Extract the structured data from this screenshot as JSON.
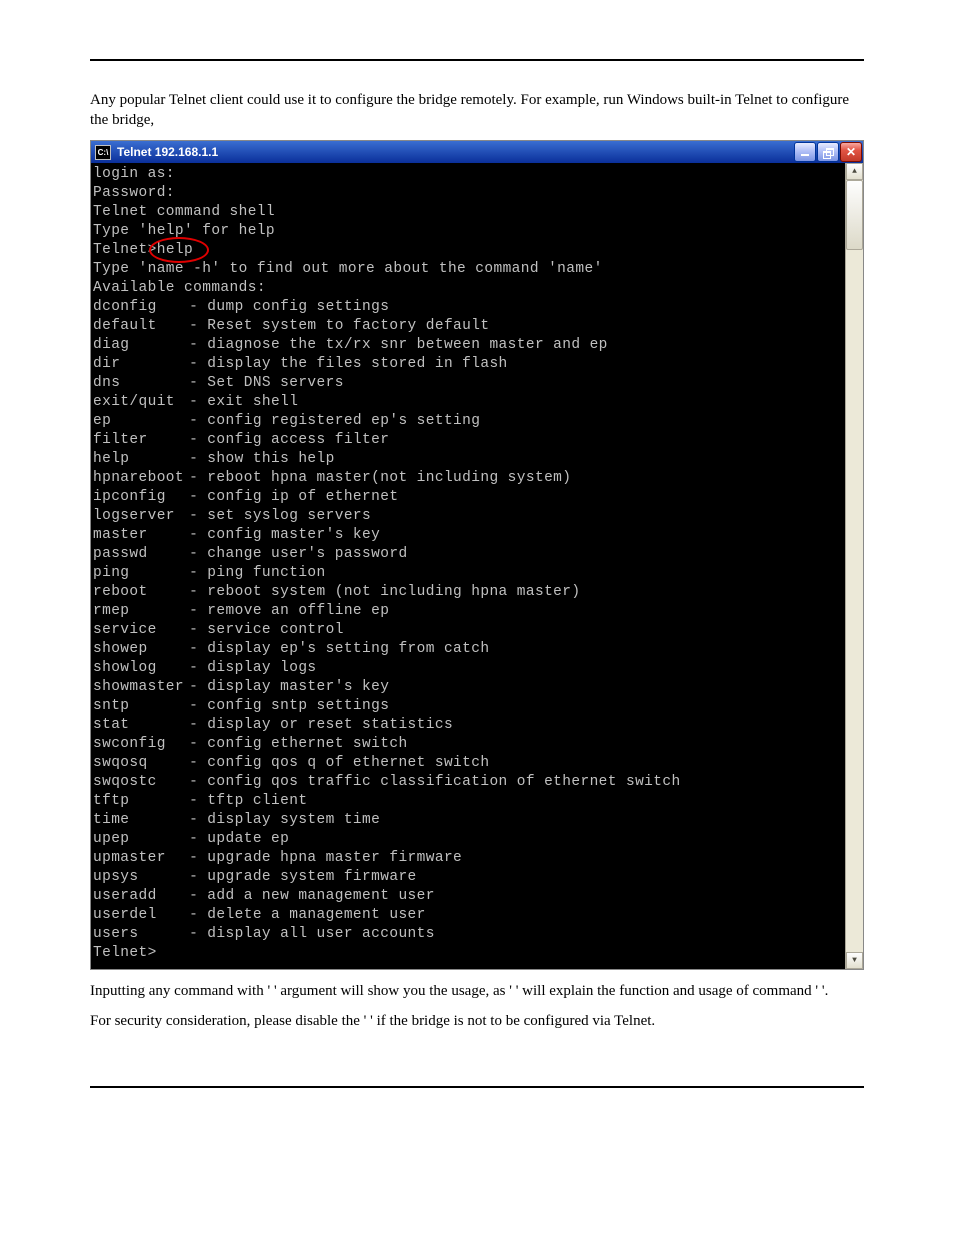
{
  "paragraphs": {
    "intro": "Any popular Telnet client could use it to configure the bridge remotely. For example, run Windows built-in Telnet to configure the bridge,",
    "usage1_a": "Inputting any command with '",
    "usage1_b": "' argument will show you the usage, as '",
    "usage1_c": "' will explain the function and usage of command '",
    "usage1_d": "'.",
    "usage1_gap1": "    ",
    "usage1_gap2": "               ",
    "usage1_gap3": "            ",
    "security_a": "For security consideration, please disable the '",
    "security_b": "' if the bridge is not to be configured via Telnet.",
    "security_gap": "                        "
  },
  "window": {
    "icon_label": "C:\\",
    "title": "Telnet 192.168.1.1"
  },
  "term": {
    "header": [
      "login as:",
      "Password:",
      "Telnet command shell",
      "Type 'help' for help"
    ],
    "prompt_prefix": "Telnet>",
    "typed": "help",
    "after_prompt": [
      "Type 'name -h' to find out more about the command 'name'",
      "Available commands:"
    ],
    "commands": [
      {
        "name": "dconfig",
        "desc": "- dump config settings"
      },
      {
        "name": "default",
        "desc": "- Reset system to factory default"
      },
      {
        "name": "diag",
        "desc": "- diagnose the tx/rx snr between master and ep"
      },
      {
        "name": "dir",
        "desc": "- display the files stored in flash"
      },
      {
        "name": "dns",
        "desc": "- Set DNS servers"
      },
      {
        "name": "exit/quit",
        "desc": "- exit shell"
      },
      {
        "name": "ep",
        "desc": "- config registered ep's setting"
      },
      {
        "name": "filter",
        "desc": "- config access filter"
      },
      {
        "name": "help",
        "desc": "- show this help"
      },
      {
        "name": "hpnareboot",
        "desc": "- reboot hpna master(not including system)"
      },
      {
        "name": "ipconfig",
        "desc": "- config ip of ethernet"
      },
      {
        "name": "logserver",
        "desc": "- set syslog servers"
      },
      {
        "name": "master",
        "desc": "- config master's key"
      },
      {
        "name": "passwd",
        "desc": "- change user's password"
      },
      {
        "name": "ping",
        "desc": "- ping function"
      },
      {
        "name": "reboot",
        "desc": "- reboot system (not including hpna master)"
      },
      {
        "name": "rmep",
        "desc": "- remove an offline ep"
      },
      {
        "name": "service",
        "desc": "- service control"
      },
      {
        "name": "showep",
        "desc": "- display ep's setting from catch"
      },
      {
        "name": "showlog",
        "desc": "- display logs"
      },
      {
        "name": "showmaster",
        "desc": "- display master's key"
      },
      {
        "name": "sntp",
        "desc": "- config sntp settings"
      },
      {
        "name": "stat",
        "desc": "- display or reset statistics"
      },
      {
        "name": "swconfig",
        "desc": "- config ethernet switch"
      },
      {
        "name": "swqosq",
        "desc": "- config qos q of ethernet switch"
      },
      {
        "name": "swqostc",
        "desc": "- config qos traffic classification of ethernet switch"
      },
      {
        "name": "tftp",
        "desc": "- tftp client"
      },
      {
        "name": "time",
        "desc": "- display system time"
      },
      {
        "name": "upep",
        "desc": "- update ep"
      },
      {
        "name": "upmaster",
        "desc": "- upgrade hpna master firmware"
      },
      {
        "name": "upsys",
        "desc": "- upgrade system firmware"
      },
      {
        "name": "useradd",
        "desc": "- add a new management user"
      },
      {
        "name": "userdel",
        "desc": "- delete a management user"
      },
      {
        "name": "users",
        "desc": "- display all user accounts"
      }
    ],
    "footer_prompt": "Telnet>"
  }
}
